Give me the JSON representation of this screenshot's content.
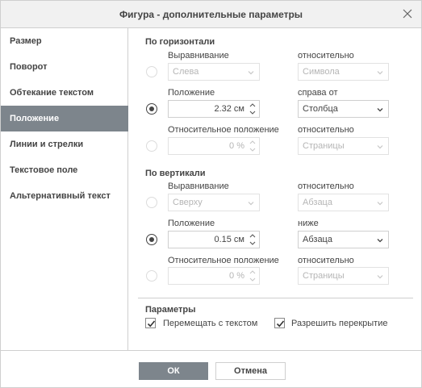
{
  "dialog": {
    "title": "Фигура - дополнительные параметры",
    "close_icon": "close-icon"
  },
  "sidebar": {
    "items": [
      {
        "label": "Размер",
        "active": false
      },
      {
        "label": "Поворот",
        "active": false
      },
      {
        "label": "Обтекание текстом",
        "active": false
      },
      {
        "label": "Положение",
        "active": true
      },
      {
        "label": "Линии и стрелки",
        "active": false
      },
      {
        "label": "Текстовое поле",
        "active": false
      },
      {
        "label": "Альтернативный текст",
        "active": false
      }
    ]
  },
  "horizontal": {
    "title": "По горизонтали",
    "alignment_label": "Выравнивание",
    "alignment_value": "Слева",
    "alignment_relative_label": "относительно",
    "alignment_relative_value": "Символа",
    "position_label": "Положение",
    "position_value": "2.32 см",
    "position_relative_label": "справа от",
    "position_relative_value": "Столбца",
    "relative_position_label": "Относительное положение",
    "relative_position_value": "0 %",
    "relative_position_relative_label": "относительно",
    "relative_position_relative_value": "Страницы",
    "selected_option": "position"
  },
  "vertical": {
    "title": "По вертикали",
    "alignment_label": "Выравнивание",
    "alignment_value": "Сверху",
    "alignment_relative_label": "относительно",
    "alignment_relative_value": "Абзаца",
    "position_label": "Положение",
    "position_value": "0.15 см",
    "position_relative_label": "ниже",
    "position_relative_value": "Абзаца",
    "relative_position_label": "Относительное положение",
    "relative_position_value": "0 %",
    "relative_position_relative_label": "относительно",
    "relative_position_relative_value": "Страницы",
    "selected_option": "position"
  },
  "options": {
    "title": "Параметры",
    "move_with_text_label": "Перемещать с текстом",
    "move_with_text_checked": true,
    "allow_overlap_label": "Разрешить перекрытие",
    "allow_overlap_checked": true
  },
  "footer": {
    "ok_label": "ОК",
    "cancel_label": "Отмена"
  },
  "colors": {
    "accent": "#7d858c",
    "border": "#cfcfcf",
    "text": "#444444",
    "disabled_text": "#b5b5b5"
  }
}
